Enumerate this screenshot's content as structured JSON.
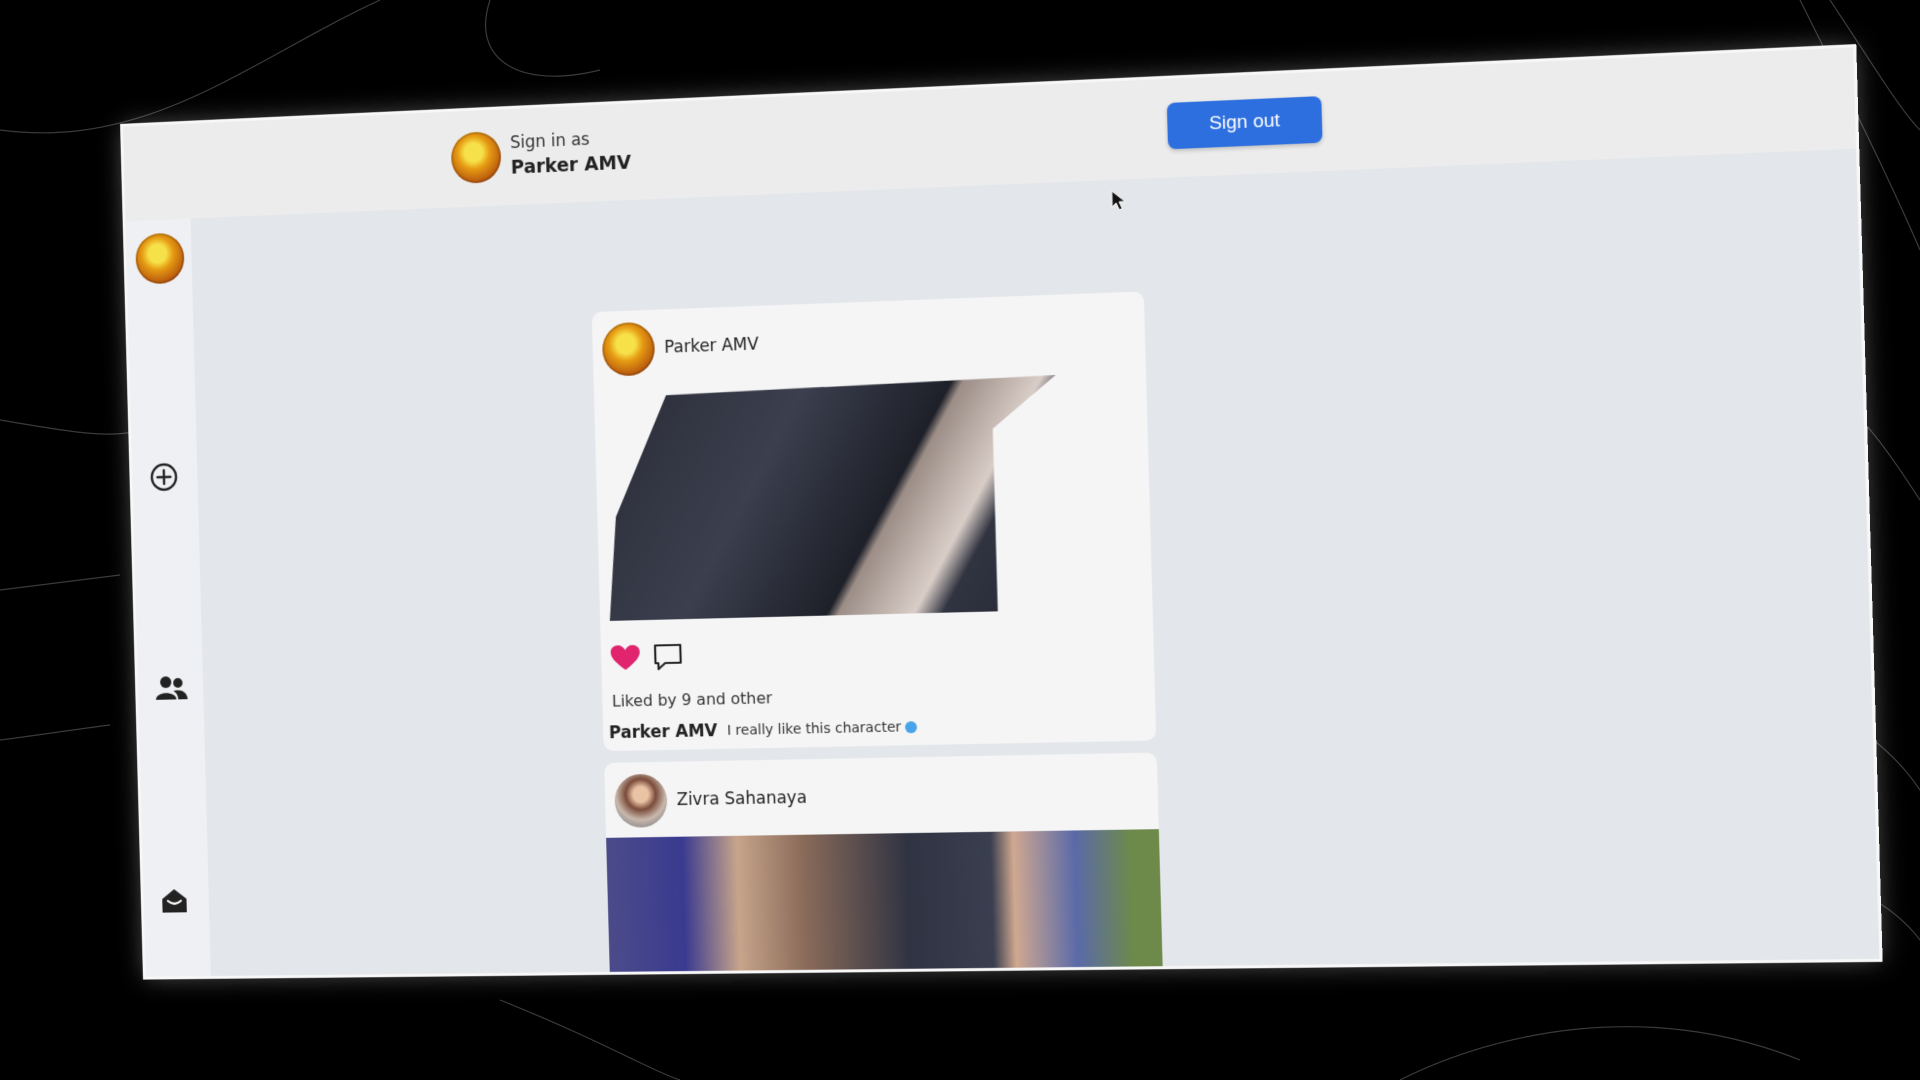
{
  "header": {
    "signin_label": "Sign in as",
    "user_name": "Parker AMV",
    "signout_label": "Sign out"
  },
  "sidebar": {
    "items": [
      {
        "icon": "avatar"
      },
      {
        "icon": "add-circle-icon"
      },
      {
        "icon": "people-icon"
      },
      {
        "icon": "inbox-icon"
      }
    ]
  },
  "posts": [
    {
      "author": "Parker AMV",
      "liked": true,
      "likes_text": "Liked by 9 and other",
      "caption_user": "Parker AMV",
      "caption_text": "I really like this character"
    },
    {
      "author": "Zivra Sahanaya"
    }
  ],
  "colors": {
    "accent": "#2e6fe0",
    "like": "#e0246e"
  }
}
